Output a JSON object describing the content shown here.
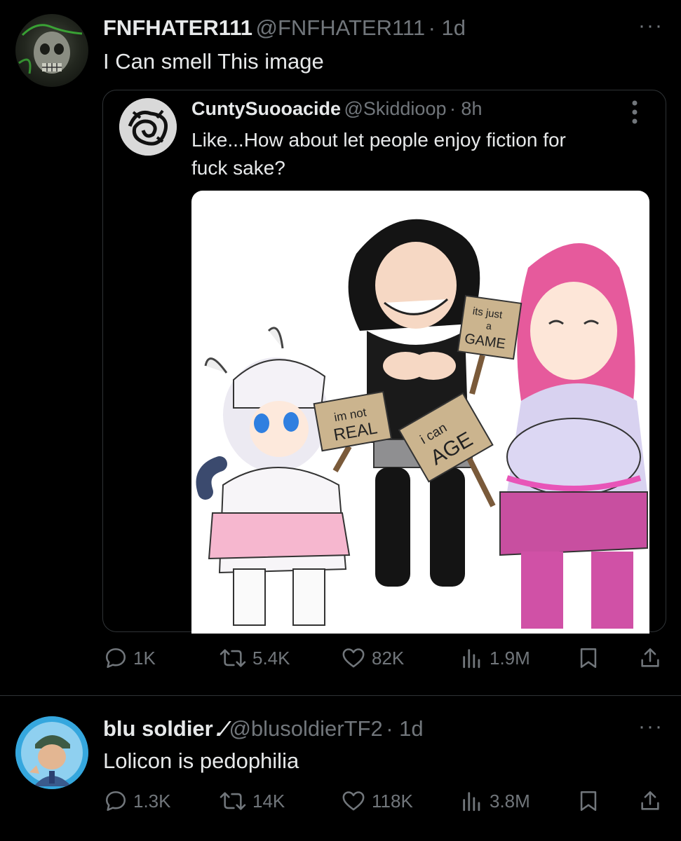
{
  "tweet1": {
    "display_name": "FNFHATER111",
    "handle": "@FNFHATER111",
    "time": "· 1d",
    "text": "I Can smell This image",
    "more_icon": "more-dots-icon",
    "quote": {
      "display_name": "CuntySuooacide",
      "handle": "@Skiddioop",
      "time": "· 8h",
      "text_line1": "Like...How about let people enjoy fiction for",
      "text_line2": "fuck sake?",
      "signs": {
        "left": [
          "im not",
          "REAL"
        ],
        "middle": [
          "its just",
          "a",
          "GAME"
        ],
        "right": [
          "i can",
          "AGE"
        ]
      }
    },
    "actions": {
      "replies": "1K",
      "reposts": "5.4K",
      "likes": "82K",
      "views": "1.9M"
    }
  },
  "tweet2": {
    "display_name": "blu soldier",
    "name_suffix": ".⁄",
    "handle": "@blusoldierTF2",
    "time": "· 1d",
    "text": "Lolicon is pedophilia",
    "actions": {
      "replies": "1.3K",
      "reposts": "14K",
      "likes": "118K",
      "views": "3.8M"
    }
  },
  "colors": {
    "background": "#000000",
    "text": "#e7e9ea",
    "muted": "#71767b",
    "border": "#2f3336"
  }
}
